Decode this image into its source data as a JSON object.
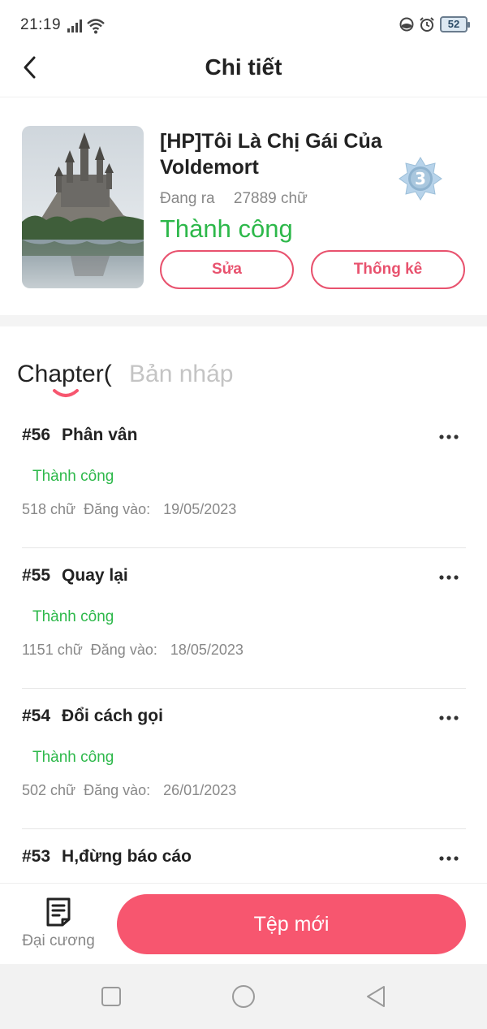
{
  "status_bar": {
    "time": "21:19",
    "battery": "52"
  },
  "header": {
    "title": "Chi tiết",
    "back_icon": "chevron-left-icon"
  },
  "book": {
    "title": "[HP]Tôi Là Chị Gái Của Voldemort",
    "state": "Đang ra",
    "word_count": "27889 chữ",
    "status": "Thành công",
    "level_badge": "3",
    "edit_label": "Sửa",
    "stats_label": "Thống kê",
    "cover_description": "castle-on-mountain-with-lake-reflection"
  },
  "tabs": {
    "chapter": "Chapter(",
    "draft": "Bản nháp"
  },
  "chapters": [
    {
      "num": "#56",
      "name": "Phân vân",
      "status": "Thành công",
      "words": "518 chữ",
      "posted_label": "Đăng vào:",
      "date": "19/05/2023"
    },
    {
      "num": "#55",
      "name": "Quay lại",
      "status": "Thành công",
      "words": "1151 chữ",
      "posted_label": "Đăng vào:",
      "date": "18/05/2023"
    },
    {
      "num": "#54",
      "name": "Đổi cách gọi",
      "status": "Thành công",
      "words": "502 chữ",
      "posted_label": "Đăng vào:",
      "date": "26/01/2023"
    },
    {
      "num": "#53",
      "name": "H,đừng báo cáo",
      "status": "",
      "words": "",
      "posted_label": "",
      "date": ""
    }
  ],
  "bottom_bar": {
    "outline_label": "Đại cương",
    "new_file_label": "Tệp mới"
  },
  "colors": {
    "accent": "#f7566f",
    "success": "#2db84a",
    "muted": "#888888"
  }
}
